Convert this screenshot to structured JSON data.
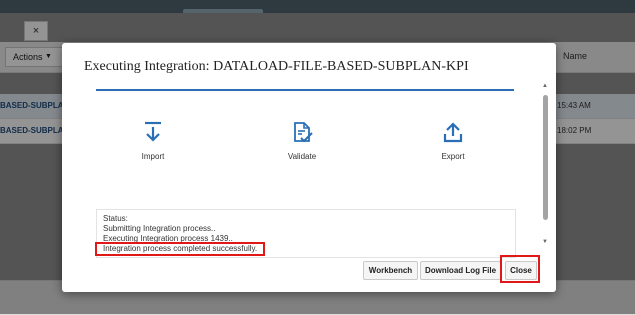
{
  "background": {
    "close_glyph": "×",
    "actions_label": "Actions",
    "name_column_header": "Name",
    "rows": [
      {
        "name": "BASED-SUBPLAN-KP",
        "time": "15:43 AM",
        "selected": true
      },
      {
        "name": "BASED-SUBPLAN-KP",
        "time": "18:02 PM",
        "selected": false
      }
    ]
  },
  "modal": {
    "title": "Executing Integration: DATALOAD-FILE-BASED-SUBPLAN-KPI",
    "steps": [
      {
        "label": "Import",
        "icon": "import-icon"
      },
      {
        "label": "Validate",
        "icon": "validate-icon"
      },
      {
        "label": "Export",
        "icon": "export-icon"
      }
    ],
    "status_lines": [
      "Status:",
      "Submitting Integration process..",
      "Executing Integration process 1439..",
      "Integration process completed successfully."
    ],
    "buttons": {
      "workbench": "Workbench",
      "download_log": "Download Log File",
      "close": "Close"
    }
  },
  "colors": {
    "accent": "#2a6fb5",
    "highlight": "#e01818"
  }
}
